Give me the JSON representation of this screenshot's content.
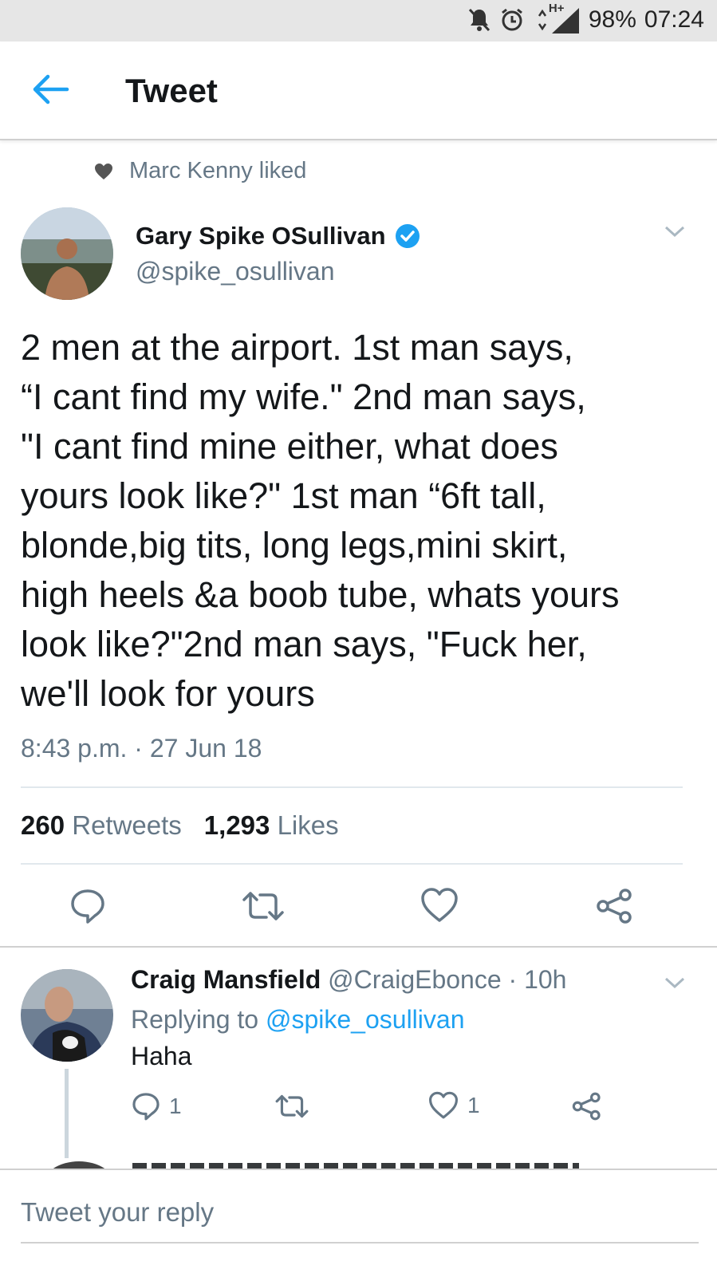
{
  "status_bar": {
    "battery": "98%",
    "time": "07:24",
    "network": "H+"
  },
  "header": {
    "title": "Tweet"
  },
  "social_context": {
    "text": "Marc Kenny liked"
  },
  "tweet": {
    "author_name": "Gary Spike OSullivan",
    "author_handle": "@spike_osullivan",
    "verified": true,
    "text": "2 men at the airport. 1st man says,\n“I cant find my wife.\" 2nd man says,\n\"I cant find mine either, what does\nyours look like?\" 1st man  “6ft tall,\nblonde,big tits, long legs,mini skirt,\nhigh heels &a boob tube, whats yours\nlook like?\"2nd man says, \"Fuck her,\nwe'll look for yours",
    "timestamp": "8:43 p.m. · 27 Jun 18",
    "retweets_count": "260",
    "retweets_label": "Retweets",
    "likes_count": "1,293",
    "likes_label": "Likes"
  },
  "reply": {
    "author_name": "Craig Mansfield",
    "author_handle": "@CraigEbonce",
    "time": "· 10h",
    "replying_prefix": "Replying to",
    "replying_to": "@spike_osullivan",
    "text": "Haha",
    "reply_count": "1",
    "like_count": "1"
  },
  "composer": {
    "placeholder": "Tweet your reply"
  },
  "colors": {
    "accent": "#1da1f2",
    "secondary_text": "#657786",
    "primary_text": "#14171a"
  },
  "icons": [
    "back-arrow-icon",
    "heart-icon",
    "verified-icon",
    "chevron-down-icon",
    "reply-icon",
    "retweet-icon",
    "like-icon",
    "share-icon",
    "silent-icon",
    "alarm-icon",
    "signal-icon"
  ]
}
